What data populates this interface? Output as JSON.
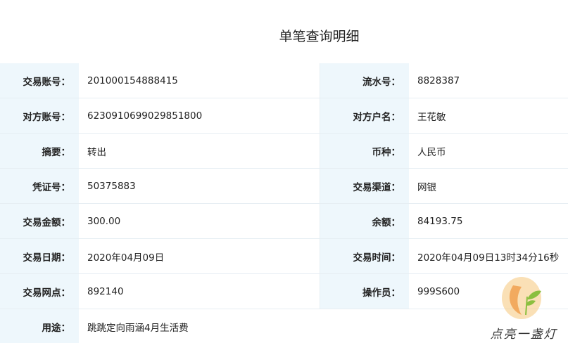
{
  "page": {
    "title": "单笔查询明细"
  },
  "rows": [
    {
      "l1": "交易账号：",
      "v1": "201000154888415",
      "l2": "流水号：",
      "v2": "8828387"
    },
    {
      "l1": "对方账号：",
      "v1": "6230910699029851800",
      "l2": "对方户名：",
      "v2": "王花敏"
    },
    {
      "l1": "摘要：",
      "v1": "转出",
      "l2": "币种：",
      "v2": "人民币"
    },
    {
      "l1": "凭证号：",
      "v1": "50375883",
      "l2": "交易渠道：",
      "v2": "网银"
    },
    {
      "l1": "交易金额：",
      "v1": "300.00",
      "l2": "余额：",
      "v2": "84193.75"
    },
    {
      "l1": "交易日期：",
      "v1": "2020年04月09日",
      "l2": "交易时间：",
      "v2": "2020年04月09日13时34分16秒"
    },
    {
      "l1": "交易网点：",
      "v1": "892140",
      "l2": "操作员：",
      "v2": "999S600"
    }
  ],
  "purpose": {
    "label": "用途：",
    "value": "跳跳定向雨涵4月生活费"
  },
  "watermark": {
    "text": "点亮一盏灯",
    "colors": {
      "flame": "#f0a050",
      "leaf": "#8bbf3f",
      "bulb": "#f6c77a"
    }
  }
}
